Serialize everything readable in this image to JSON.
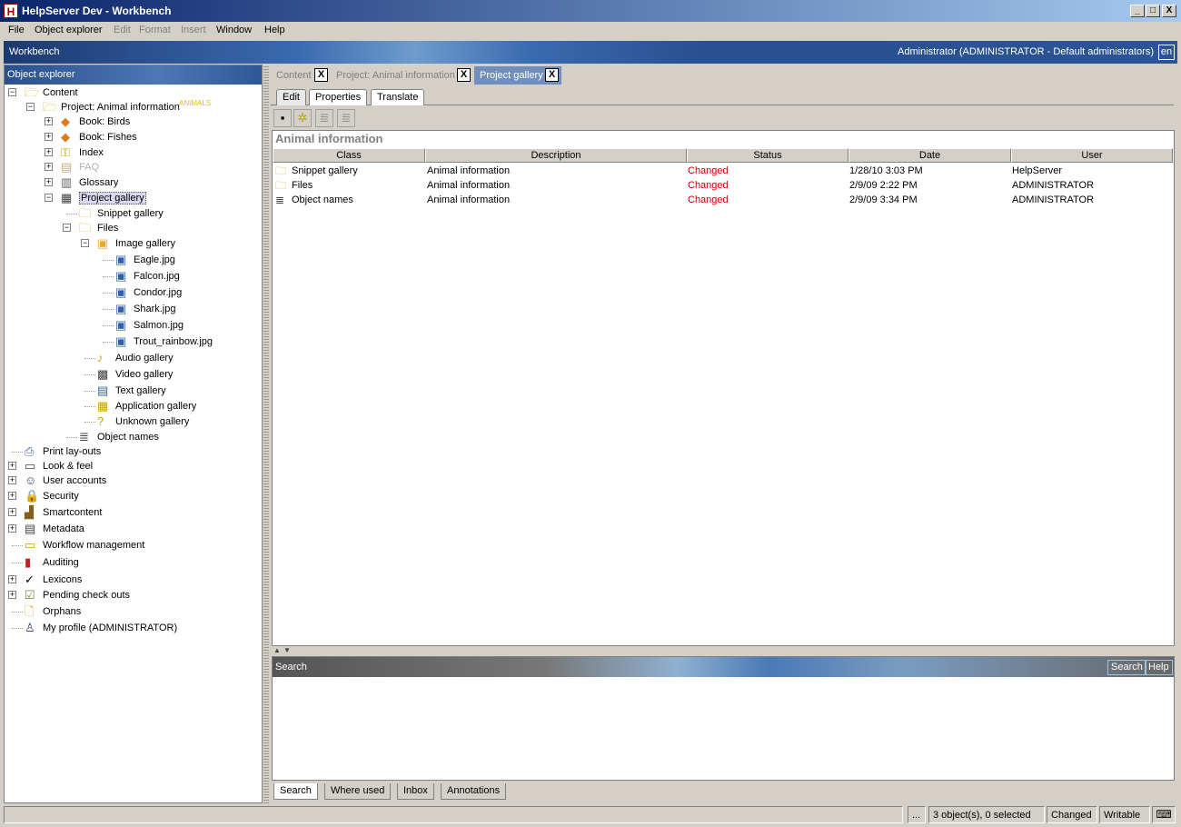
{
  "window": {
    "title": "HelpServer Dev - Workbench",
    "app_icon": "H",
    "minimize": "_",
    "maximize": "□",
    "close": "X"
  },
  "menu": {
    "items": [
      {
        "label": "File",
        "enabled": true
      },
      {
        "label": "Object explorer",
        "enabled": true
      },
      {
        "label": "Edit",
        "enabled": false
      },
      {
        "label": "Format",
        "enabled": false
      },
      {
        "label": "Insert",
        "enabled": false
      },
      {
        "label": "Window",
        "enabled": true
      },
      {
        "label": "Help",
        "enabled": true
      }
    ]
  },
  "workbench": {
    "title": "Workbench",
    "user": "Administrator (ADMINISTRATOR - Default administrators)",
    "language": "en"
  },
  "explorer": {
    "header": "Object explorer",
    "tree": [
      {
        "label": "Content",
        "icon": "folder-open-icon",
        "expander": "−"
      },
      {
        "label": "Project: Animal information",
        "icon": "project-folder-icon",
        "expander": "−",
        "tag": "ANIMALS"
      },
      {
        "label": "Book: Birds",
        "icon": "book-icon",
        "expander": "+"
      },
      {
        "label": "Book: Fishes",
        "icon": "book-icon",
        "expander": "+"
      },
      {
        "label": "Index",
        "icon": "index-key-icon",
        "expander": "+"
      },
      {
        "label": "FAQ",
        "icon": "faq-icon",
        "expander": "+"
      },
      {
        "label": "Glossary",
        "icon": "glossary-icon",
        "expander": "+"
      },
      {
        "label": "Project gallery",
        "icon": "gallery-icon",
        "expander": "−"
      },
      {
        "label": "Snippet gallery",
        "icon": "folder-icon",
        "expander": ""
      },
      {
        "label": "Files",
        "icon": "folder-icon",
        "expander": "−"
      },
      {
        "label": "Image gallery",
        "icon": "image-gallery-icon",
        "expander": "−"
      },
      {
        "label": "Eagle.jpg",
        "icon": "image-file-icon",
        "expander": ""
      },
      {
        "label": "Falcon.jpg",
        "icon": "image-file-icon",
        "expander": ""
      },
      {
        "label": "Condor.jpg",
        "icon": "image-file-icon",
        "expander": ""
      },
      {
        "label": "Shark.jpg",
        "icon": "image-file-icon",
        "expander": ""
      },
      {
        "label": "Salmon.jpg",
        "icon": "image-file-icon",
        "expander": ""
      },
      {
        "label": "Trout_rainbow.jpg",
        "icon": "image-file-icon",
        "expander": ""
      },
      {
        "label": "Audio gallery",
        "icon": "audio-gallery-icon",
        "expander": ""
      },
      {
        "label": "Video gallery",
        "icon": "video-gallery-icon",
        "expander": ""
      },
      {
        "label": "Text gallery",
        "icon": "text-gallery-icon",
        "expander": ""
      },
      {
        "label": "Application gallery",
        "icon": "application-gallery-icon",
        "expander": ""
      },
      {
        "label": "Unknown gallery",
        "icon": "unknown-gallery-icon",
        "expander": ""
      },
      {
        "label": "Object names",
        "icon": "list-icon",
        "expander": ""
      },
      {
        "label": "Print lay-outs",
        "icon": "printer-icon",
        "expander": ""
      },
      {
        "label": "Look & feel",
        "icon": "look-feel-icon",
        "expander": "+"
      },
      {
        "label": "User accounts",
        "icon": "users-icon",
        "expander": "+"
      },
      {
        "label": "Security",
        "icon": "lock-icon",
        "expander": "+"
      },
      {
        "label": "Smartcontent",
        "icon": "smartcontent-icon",
        "expander": "+"
      },
      {
        "label": "Metadata",
        "icon": "metadata-icon",
        "expander": "+"
      },
      {
        "label": "Workflow management",
        "icon": "workflow-icon",
        "expander": ""
      },
      {
        "label": "Auditing",
        "icon": "chart-icon",
        "expander": ""
      },
      {
        "label": "Lexicons",
        "icon": "spellcheck-icon",
        "expander": "+"
      },
      {
        "label": "Pending check outs",
        "icon": "checkout-icon",
        "expander": "+"
      },
      {
        "label": "Orphans",
        "icon": "orphans-icon",
        "expander": ""
      },
      {
        "label": "My profile (ADMINISTRATOR)",
        "icon": "user-profile-icon",
        "expander": ""
      }
    ]
  },
  "tabs": {
    "items": [
      {
        "label": "Content",
        "close": "X",
        "active": false
      },
      {
        "label": "Project: Animal information",
        "close": "X",
        "active": false
      },
      {
        "label": "Project gallery",
        "close": "X",
        "active": true
      }
    ]
  },
  "subtabs": {
    "items": [
      "Edit",
      "Properties",
      "Translate"
    ]
  },
  "toolbar": {
    "buttons": [
      {
        "icon": "save-icon"
      },
      {
        "icon": "refresh-icon"
      },
      {
        "icon": "outdent-icon"
      },
      {
        "icon": "indent-icon"
      }
    ]
  },
  "main": {
    "title": "Animal information",
    "columns": [
      "Class",
      "Description",
      "Status",
      "Date",
      "User"
    ],
    "rows": [
      {
        "class": "Snippet gallery",
        "icon": "folder-icon",
        "description": "Animal information",
        "status": "Changed",
        "date": "1/28/10 3:03 PM",
        "user": "HelpServer"
      },
      {
        "class": "Files",
        "icon": "folder-icon",
        "description": "Animal information",
        "status": "Changed",
        "date": "2/9/09 2:22 PM",
        "user": "ADMINISTRATOR"
      },
      {
        "class": "Object names",
        "icon": "list-icon",
        "description": "Animal information",
        "status": "Changed",
        "date": "2/9/09 3:34 PM",
        "user": "ADMINISTRATOR"
      }
    ],
    "status_color": "#c00000"
  },
  "search": {
    "title": "Search",
    "search_button": "Search",
    "help_button": "Help"
  },
  "bottom_tabs": {
    "items": [
      "Search",
      "Where used",
      "Inbox",
      "Annotations"
    ]
  },
  "statusbar": {
    "ellipsis": "...",
    "selection": "3 object(s), 0 selected",
    "state": "Changed",
    "mode": "Writable",
    "keyboard_icon": "keyboard-icon"
  }
}
